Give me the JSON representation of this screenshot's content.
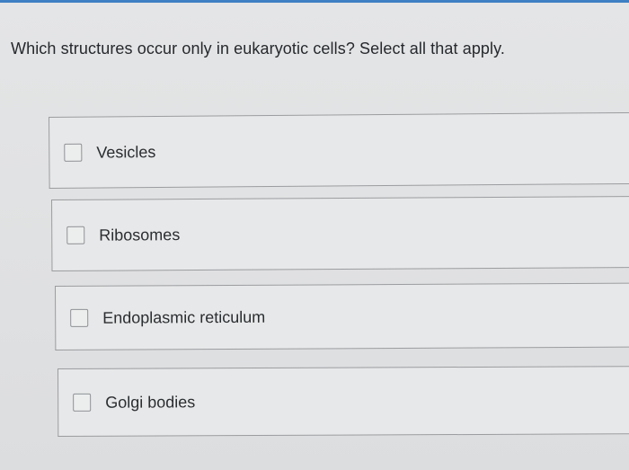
{
  "question": {
    "text": "Which structures occur only in eukaryotic cells? Select all that apply."
  },
  "options": [
    {
      "label": "Vesicles",
      "checked": false
    },
    {
      "label": "Ribosomes",
      "checked": false
    },
    {
      "label": "Endoplasmic reticulum",
      "checked": false
    },
    {
      "label": "Golgi bodies",
      "checked": false
    }
  ],
  "colors": {
    "accent": "#3f7fc4",
    "border": "#9a9c9f",
    "text": "#26292d"
  }
}
